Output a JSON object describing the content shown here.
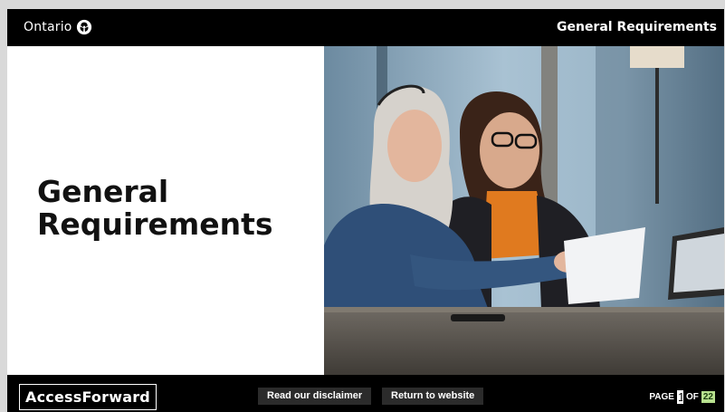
{
  "header": {
    "logo_text": "Ontario",
    "title": "General Requirements"
  },
  "main": {
    "heading_line1": "General",
    "heading_line2": "Requirements",
    "photo_icon": "photo-two-women-reviewing-documents"
  },
  "footer": {
    "brand": "AccessForward",
    "disclaimer_label": "Read our disclaimer",
    "return_label": "Return to website",
    "page_label": "PAGE",
    "page_current": "1",
    "of_label": "OF",
    "page_total": "22"
  },
  "colors": {
    "bar": "#000000",
    "button_bg": "#2b2b2b",
    "page_total_bg": "#b7e08e"
  }
}
